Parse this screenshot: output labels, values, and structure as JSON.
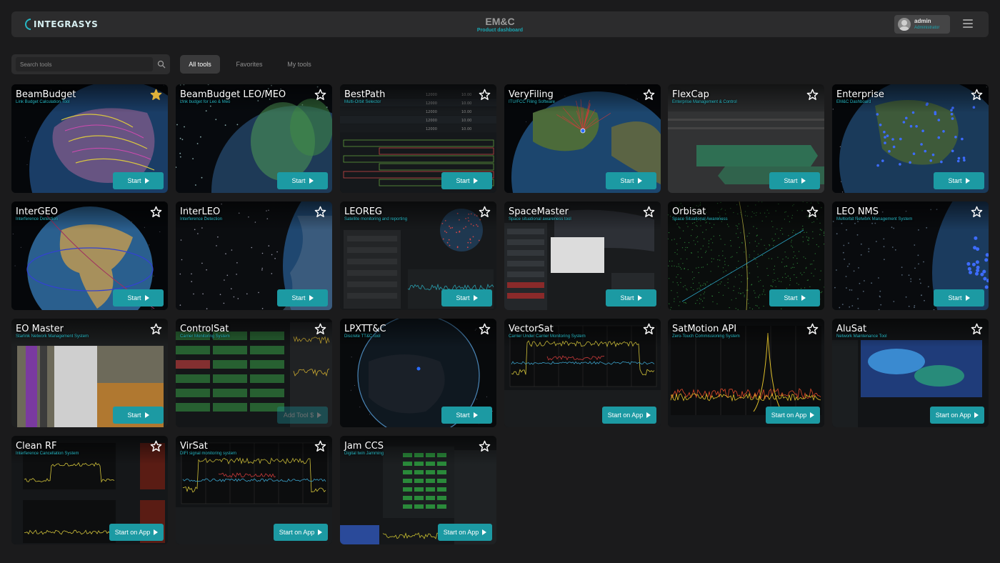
{
  "header": {
    "logo_text": "INTEGRASYS",
    "title": "EM&C",
    "subtitle": "Product dashboard",
    "user": {
      "name": "admin",
      "role": "Administrator"
    },
    "menu_icon": "hamburger-icon"
  },
  "toolbar": {
    "search_placeholder": "Search tools",
    "search_icon": "search-icon",
    "tabs": [
      "All tools",
      "Favorites",
      "My tools"
    ],
    "active_tab": "All tools"
  },
  "colors": {
    "accent": "#1c9aa3",
    "accent_text": "#27b7c4",
    "background": "#1b1b1c",
    "panel": "#2c2c2d",
    "favorite_star": "#e0b23a"
  },
  "tools": [
    {
      "title": "BeamBudget",
      "subtitle": "Link Budget Calculation Tool",
      "button": "Start",
      "favorite": true,
      "art": "globe-earth"
    },
    {
      "title": "BeamBudget LEO/MEO",
      "subtitle": "Link budget for Leo & Meo",
      "button": "Start",
      "favorite": false,
      "art": "globe-coverage"
    },
    {
      "title": "BestPath",
      "subtitle": "Multi-Orbit Selector",
      "button": "Start",
      "favorite": false,
      "art": "table-bars"
    },
    {
      "title": "VeryFiling",
      "subtitle": "ITU/FCC Filing Software",
      "button": "Start",
      "favorite": false,
      "art": "globe-atlantic"
    },
    {
      "title": "FlexCap",
      "subtitle": "Enterprise Management & Control",
      "button": "Start",
      "favorite": false,
      "art": "gantt"
    },
    {
      "title": "Enterprise",
      "subtitle": "EM&C Dashboard",
      "button": "Start",
      "favorite": false,
      "art": "globe-night"
    },
    {
      "title": "InterGEO",
      "subtitle": "Interference Detection",
      "button": "Start",
      "favorite": false,
      "art": "globe-africa"
    },
    {
      "title": "InterLEO",
      "subtitle": "Interference Detection",
      "button": "Start",
      "favorite": false,
      "art": "globe-edge"
    },
    {
      "title": "LEOREG",
      "subtitle": "Satellite monitoring and reporting",
      "button": "Start",
      "favorite": false,
      "art": "panel-globe"
    },
    {
      "title": "SpaceMaster",
      "subtitle": "Space situational awareness tool",
      "button": "Start",
      "favorite": false,
      "art": "panel-map"
    },
    {
      "title": "Orbisat",
      "subtitle": "Space Situational Awareness",
      "button": "Start",
      "favorite": false,
      "art": "dots-green"
    },
    {
      "title": "LEO NMS",
      "subtitle": "Multiorbit Network Management System",
      "button": "Start",
      "favorite": false,
      "art": "globe-edge-blue"
    },
    {
      "title": "EO Master",
      "subtitle": "Starlink Network Management System",
      "button": "Start",
      "favorite": false,
      "art": "aerial"
    },
    {
      "title": "ControlSat",
      "subtitle": "Carrier Monitoring System",
      "button": "Add Tool $",
      "favorite": false,
      "art": "cells"
    },
    {
      "title": "LPXTT&C",
      "subtitle": "Discrete TT&C tool",
      "button": "Start",
      "favorite": false,
      "art": "globe-dark"
    },
    {
      "title": "VectorSat",
      "subtitle": "Carrier Under Carrier Monitoring System",
      "button": "Start on App",
      "favorite": false,
      "art": "spectrum"
    },
    {
      "title": "SatMotion API",
      "subtitle": "Zero-Touch Commissioning System",
      "button": "Start on App",
      "favorite": false,
      "art": "spectrum-peak"
    },
    {
      "title": "AluSat",
      "subtitle": "Network Maintenance Tool",
      "button": "Start on App",
      "favorite": false,
      "art": "weather"
    },
    {
      "title": "Clean RF",
      "subtitle": "Interference Cancellation System",
      "button": "Start on App",
      "favorite": false,
      "art": "plots"
    },
    {
      "title": "VirSat",
      "subtitle": "DIFI signal monitoring system",
      "button": "Start on App",
      "favorite": false,
      "art": "spectrum"
    },
    {
      "title": "Jam CCS",
      "subtitle": "Digital twin Jamming",
      "button": "Start on App",
      "favorite": false,
      "art": "console"
    }
  ]
}
